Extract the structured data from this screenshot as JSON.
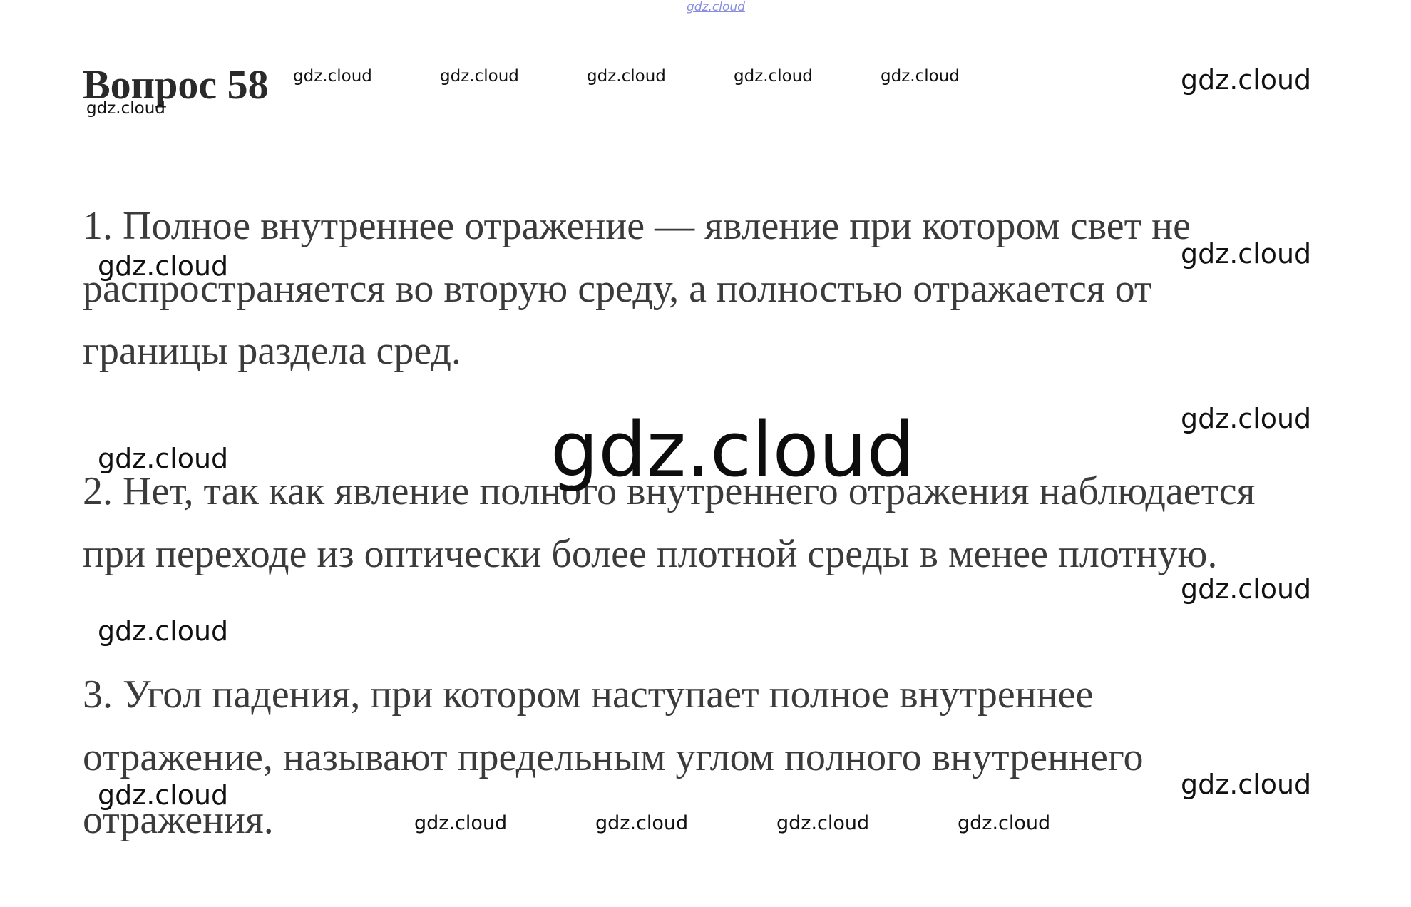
{
  "title": "Вопрос 58",
  "answers": [
    {
      "lines": [
        "1. Полное внутреннее отражение — явление при котором свет не",
        "распространяется во вторую среду, а полностью отражается от",
        "границы раздела сред."
      ]
    },
    {
      "lines": [
        "2. Нет, так как явление полного внутреннего отражения наблюдается",
        "при переходе из оптически более плотной среды в менее плотную."
      ]
    },
    {
      "lines": [
        "3. Угол падения, при котором наступает полное внутреннее",
        "отражение, называют предельным углом полного внутреннего",
        "отражения."
      ]
    }
  ],
  "watermark": {
    "text": "gdz.cloud"
  }
}
